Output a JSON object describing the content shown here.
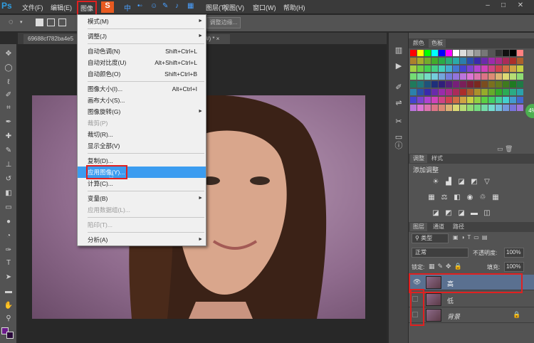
{
  "menubar": {
    "logo": "Ps",
    "items": [
      "文件(F)",
      "编辑(E)",
      "图像",
      "图层(T)",
      "视图(V)",
      "窗口(W)",
      "帮助(H)"
    ],
    "badge": "S",
    "ime": "中"
  },
  "optbar": {
    "refine_edge": "调整边缘..."
  },
  "doc": {
    "tab1": "69688cf782ba4e5",
    "tab2": "#) * ×"
  },
  "image_menu": [
    {
      "label": "模式(M)",
      "arrow": "►"
    },
    {
      "sep": true
    },
    {
      "label": "调整(J)",
      "arrow": "►"
    },
    {
      "sep": true
    },
    {
      "label": "自动色调(N)",
      "shortcut": "Shift+Ctrl+L"
    },
    {
      "label": "自动对比度(U)",
      "shortcut": "Alt+Shift+Ctrl+L"
    },
    {
      "label": "自动颜色(O)",
      "shortcut": "Shift+Ctrl+B"
    },
    {
      "sep": true
    },
    {
      "label": "图像大小(I)...",
      "shortcut": "Alt+Ctrl+I"
    },
    {
      "label": "画布大小(S)..."
    },
    {
      "label": "图像旋转(G)",
      "arrow": "►"
    },
    {
      "label": "裁剪(P)",
      "disabled": true
    },
    {
      "label": "裁切(R)..."
    },
    {
      "label": "显示全部(V)"
    },
    {
      "sep": true
    },
    {
      "label": "复制(D)..."
    },
    {
      "label": "应用图像(Y)...",
      "selected": true
    },
    {
      "label": "计算(C)..."
    },
    {
      "sep": true
    },
    {
      "label": "变量(B)",
      "arrow": "►"
    },
    {
      "label": "应用数据组(L)...",
      "disabled": true
    },
    {
      "sep": true
    },
    {
      "label": "陷印(T)...",
      "disabled": true
    },
    {
      "sep": true
    },
    {
      "label": "分析(A)",
      "arrow": "►"
    }
  ],
  "panels": {
    "swatch_tabs": [
      "颜色",
      "色板"
    ],
    "adj_tabs": [
      "调整",
      "样式"
    ],
    "adj_title": "添加调整",
    "layer_tabs": [
      "图层",
      "通道",
      "路径"
    ],
    "kind": "类型",
    "blend": "正常",
    "opacity_label": "不透明度:",
    "opacity": "100%",
    "lock_label": "锁定:",
    "fill_label": "填充:",
    "fill": "100%",
    "layers": [
      {
        "name": "高",
        "visible": true,
        "selected": true
      },
      {
        "name": "低",
        "visible": false,
        "selected": false
      },
      {
        "name": "背景",
        "visible": false,
        "selected": false,
        "locked": true
      }
    ]
  },
  "colors": {
    "accent": "#3b9cf0",
    "highlight": "#e02020"
  }
}
